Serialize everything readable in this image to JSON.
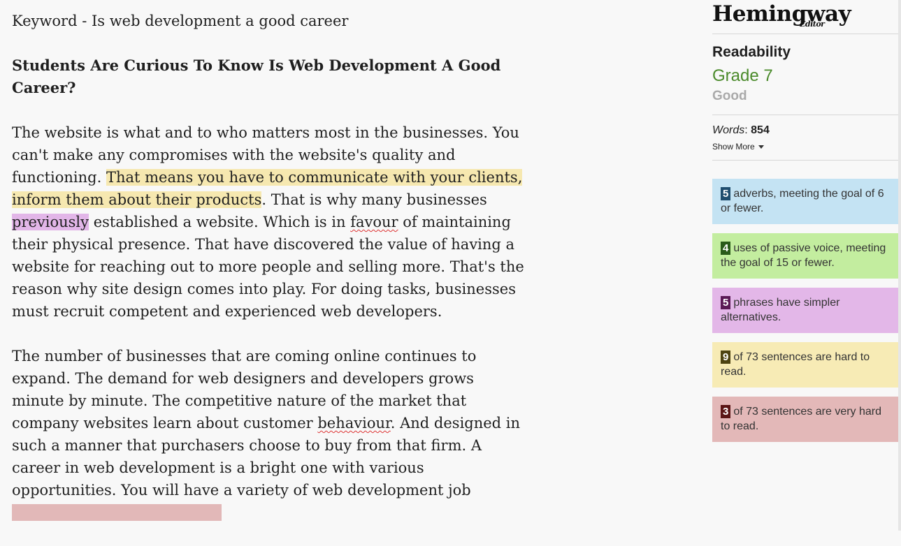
{
  "editor": {
    "keyword": "Keyword - Is web development a good career",
    "heading": "Students Are Curious To Know Is Web Development A Good Career?",
    "p1": {
      "s1": "The website is what and to who matters most in the businesses. You can't make any compromises with the website's quality and functioning. ",
      "hl1": "That means you have to communicate with your clients, inform them about their products",
      "s2": ". That is why many businesses ",
      "adverb": "previously",
      "s3": " established a website. Which is in ",
      "spell1": "favour",
      "s4": " of maintaining their physical presence. That have discovered the value of having a website for reaching out to more people and selling more. That's the reason why site design comes into play. For doing tasks, businesses must recruit competent and experienced web developers."
    },
    "p2": {
      "s1": "The number of businesses that are coming online continues to expand. The demand for web designers and developers grows minute by minute. The competitive nature of the market that company websites learn about customer ",
      "spell2": "behaviour",
      "s2": ". And designed in such a manner that purchasers choose to buy from that firm. A career in web development is a bright one with various opportunities. You will have a variety of web development job "
    }
  },
  "sidebar": {
    "logo": "Hemingway",
    "logo_sub": "Editor",
    "readability_label": "Readability",
    "grade": "Grade 7",
    "grade_rating": "Good",
    "words_label": "Words",
    "words_colon": ":",
    "words_count": "854",
    "show_more": "Show More",
    "cards": [
      {
        "count": "5",
        "text": "adverbs, meeting the goal of 6 or fewer."
      },
      {
        "count": "4",
        "text": "uses of passive voice, meeting the goal of 15 or fewer."
      },
      {
        "count": "5",
        "text": "phrases have simpler alternatives."
      },
      {
        "count": "9",
        "text": "of 73 sentences are hard to read."
      },
      {
        "count": "3",
        "text": "of 73 sentences are very hard to read."
      }
    ]
  },
  "colors": {
    "adverb": "#c4e3f3",
    "passive": "#c3ed9f",
    "simpler": "#e3b7e8",
    "hard": "#f7ebb5",
    "very_hard": "#e3b8b8",
    "grade_green": "#4a8a2a"
  }
}
